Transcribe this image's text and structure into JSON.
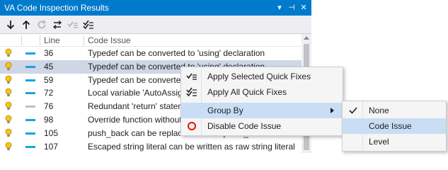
{
  "window": {
    "title": "VA Code Inspection Results",
    "dropdown_glyph": "▾",
    "pin_glyph": "⊣",
    "close_glyph": "✕"
  },
  "toolbar": {
    "icons": [
      "arrow-down-icon",
      "arrow-up-icon",
      "refresh-icon",
      "swap-icon",
      "apply-quick-fix-icon",
      "apply-all-quick-fixes-icon"
    ]
  },
  "columns": {
    "line": "Line",
    "issue": "Code Issue"
  },
  "rows": [
    {
      "line": "36",
      "issue": "Typedef can be converted to 'using' declaration",
      "severity_color": "#1ba1e2"
    },
    {
      "line": "45",
      "issue": "Typedef can be converted to 'using' declaration",
      "severity_color": "#1ba1e2",
      "selected": true
    },
    {
      "line": "59",
      "issue": "Typedef can be converted to 'using' declaration",
      "severity_color": "#1ba1e2"
    },
    {
      "line": "72",
      "issue": "Local variable 'AutoAssign' can be declared 'auto'",
      "severity_color": "#1ba1e2"
    },
    {
      "line": "76",
      "issue": "Redundant 'return' statement",
      "severity_color": "#c0c0c0"
    },
    {
      "line": "98",
      "issue": "Override function without 'override' specifier",
      "severity_color": "#1ba1e2"
    },
    {
      "line": "105",
      "issue": "push_back can be replaced with emplace_back",
      "severity_color": "#1ba1e2"
    },
    {
      "line": "107",
      "issue": "Escaped string literal can be written as raw string literal",
      "severity_color": "#1ba1e2"
    }
  ],
  "context_menu": {
    "apply_selected": "Apply Selected Quick Fixes",
    "apply_all": "Apply All Quick Fixes",
    "group_by": "Group By",
    "disable": "Disable Code Issue"
  },
  "group_by_menu": {
    "none": "None",
    "code_issue": "Code Issue",
    "level": "Level",
    "checked": "None"
  },
  "colors": {
    "title_bar": "#007acc",
    "selected_row": "#cfd6e5",
    "menu_highlight": "#c9def5",
    "info_severity": "#1ba1e2",
    "disable_icon": "#e51400"
  }
}
